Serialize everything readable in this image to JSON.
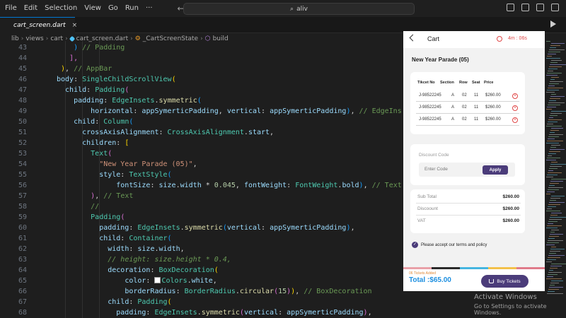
{
  "menu": [
    "File",
    "Edit",
    "Selection",
    "View",
    "Go",
    "Run",
    "···"
  ],
  "search": {
    "text": "aliv"
  },
  "tab": {
    "label": "cart_screen.dart",
    "close": "×"
  },
  "breadcrumb": [
    "lib",
    "views",
    "cart",
    "cart_screen.dart",
    "_CartScreenState",
    "build"
  ],
  "code_lines": [
    {
      "num": "43",
      "indent": 8,
      "tokens": [
        {
          "t": ") ",
          "c": "br3"
        },
        {
          "t": "// Padding",
          "c": "c"
        }
      ]
    },
    {
      "num": "44",
      "indent": 7,
      "tokens": [
        {
          "t": "],",
          "c": "br2"
        }
      ]
    },
    {
      "num": "45",
      "indent": 5,
      "tokens": [
        {
          "t": ")",
          "c": "br1"
        },
        {
          "t": ", ",
          "c": "txt"
        },
        {
          "t": "// AppBar",
          "c": "c"
        }
      ]
    },
    {
      "num": "46",
      "indent": 4,
      "tokens": [
        {
          "t": "body",
          "c": "p"
        },
        {
          "t": ": ",
          "c": "txt"
        },
        {
          "t": "SingleChildScrollView",
          "c": "k"
        },
        {
          "t": "(",
          "c": "br1"
        }
      ]
    },
    {
      "num": "47",
      "indent": 6,
      "tokens": [
        {
          "t": "child",
          "c": "p"
        },
        {
          "t": ": ",
          "c": "txt"
        },
        {
          "t": "Padding",
          "c": "k"
        },
        {
          "t": "(",
          "c": "br2"
        }
      ]
    },
    {
      "num": "48",
      "indent": 8,
      "tokens": [
        {
          "t": "padding",
          "c": "p"
        },
        {
          "t": ": ",
          "c": "txt"
        },
        {
          "t": "EdgeInsets",
          "c": "k"
        },
        {
          "t": ".",
          "c": "txt"
        },
        {
          "t": "symmetric",
          "c": "f"
        },
        {
          "t": "(",
          "c": "br3"
        }
      ]
    },
    {
      "num": "49",
      "indent": 12,
      "tokens": [
        {
          "t": "horizontal",
          "c": "p"
        },
        {
          "t": ": ",
          "c": "txt"
        },
        {
          "t": "appSymerticPadding",
          "c": "p"
        },
        {
          "t": ", ",
          "c": "txt"
        },
        {
          "t": "vertical",
          "c": "p"
        },
        {
          "t": ": ",
          "c": "txt"
        },
        {
          "t": "appSymerticPadding",
          "c": "p"
        },
        {
          "t": ")",
          "c": "br3"
        },
        {
          "t": ", ",
          "c": "txt"
        },
        {
          "t": "// EdgeIns",
          "c": "c"
        }
      ]
    },
    {
      "num": "50",
      "indent": 8,
      "tokens": [
        {
          "t": "child",
          "c": "p"
        },
        {
          "t": ": ",
          "c": "txt"
        },
        {
          "t": "Column",
          "c": "k"
        },
        {
          "t": "(",
          "c": "br3"
        }
      ]
    },
    {
      "num": "51",
      "indent": 10,
      "tokens": [
        {
          "t": "crossAxisAlignment",
          "c": "p"
        },
        {
          "t": ": ",
          "c": "txt"
        },
        {
          "t": "CrossAxisAlignment",
          "c": "k"
        },
        {
          "t": ".",
          "c": "txt"
        },
        {
          "t": "start",
          "c": "p"
        },
        {
          "t": ",",
          "c": "txt"
        }
      ]
    },
    {
      "num": "52",
      "indent": 10,
      "tokens": [
        {
          "t": "children",
          "c": "p"
        },
        {
          "t": ": ",
          "c": "txt"
        },
        {
          "t": "[",
          "c": "br1"
        }
      ]
    },
    {
      "num": "53",
      "indent": 12,
      "tokens": [
        {
          "t": "Text",
          "c": "k"
        },
        {
          "t": "(",
          "c": "br2"
        }
      ]
    },
    {
      "num": "54",
      "indent": 14,
      "tokens": [
        {
          "t": "\"New Year Parade (05)\"",
          "c": "s"
        },
        {
          "t": ",",
          "c": "txt"
        }
      ]
    },
    {
      "num": "55",
      "indent": 14,
      "tokens": [
        {
          "t": "style",
          "c": "p"
        },
        {
          "t": ": ",
          "c": "txt"
        },
        {
          "t": "TextStyle",
          "c": "k"
        },
        {
          "t": "(",
          "c": "br3"
        }
      ]
    },
    {
      "num": "56",
      "indent": 18,
      "tokens": [
        {
          "t": "fontSize",
          "c": "p"
        },
        {
          "t": ": ",
          "c": "txt"
        },
        {
          "t": "size",
          "c": "p"
        },
        {
          "t": ".",
          "c": "txt"
        },
        {
          "t": "width",
          "c": "p"
        },
        {
          "t": " * ",
          "c": "txt"
        },
        {
          "t": "0.045",
          "c": "n"
        },
        {
          "t": ", ",
          "c": "txt"
        },
        {
          "t": "fontWeight",
          "c": "p"
        },
        {
          "t": ": ",
          "c": "txt"
        },
        {
          "t": "FontWeight",
          "c": "k"
        },
        {
          "t": ".",
          "c": "txt"
        },
        {
          "t": "bold",
          "c": "p"
        },
        {
          "t": ")",
          "c": "br3"
        },
        {
          "t": ", ",
          "c": "txt"
        },
        {
          "t": "// Text",
          "c": "c"
        }
      ]
    },
    {
      "num": "57",
      "indent": 12,
      "tokens": [
        {
          "t": ")",
          "c": "br2"
        },
        {
          "t": ", ",
          "c": "txt"
        },
        {
          "t": "// Text",
          "c": "c"
        }
      ]
    },
    {
      "num": "58",
      "indent": 12,
      "tokens": [
        {
          "t": "//",
          "c": "c"
        }
      ]
    },
    {
      "num": "59",
      "indent": 12,
      "tokens": [
        {
          "t": "Padding",
          "c": "k"
        },
        {
          "t": "(",
          "c": "br2"
        }
      ]
    },
    {
      "num": "60",
      "indent": 14,
      "tokens": [
        {
          "t": "padding",
          "c": "p"
        },
        {
          "t": ": ",
          "c": "txt"
        },
        {
          "t": "EdgeInsets",
          "c": "k"
        },
        {
          "t": ".",
          "c": "txt"
        },
        {
          "t": "symmetric",
          "c": "f"
        },
        {
          "t": "(",
          "c": "br3"
        },
        {
          "t": "vertical",
          "c": "p"
        },
        {
          "t": ": ",
          "c": "txt"
        },
        {
          "t": "appSymerticPadding",
          "c": "p"
        },
        {
          "t": ")",
          "c": "br3"
        },
        {
          "t": ",",
          "c": "txt"
        }
      ]
    },
    {
      "num": "61",
      "indent": 14,
      "tokens": [
        {
          "t": "child",
          "c": "p"
        },
        {
          "t": ": ",
          "c": "txt"
        },
        {
          "t": "Container",
          "c": "k"
        },
        {
          "t": "(",
          "c": "br3"
        }
      ]
    },
    {
      "num": "62",
      "indent": 16,
      "tokens": [
        {
          "t": "width",
          "c": "p"
        },
        {
          "t": ": ",
          "c": "txt"
        },
        {
          "t": "size",
          "c": "p"
        },
        {
          "t": ".",
          "c": "txt"
        },
        {
          "t": "width",
          "c": "p"
        },
        {
          "t": ",",
          "c": "txt"
        }
      ]
    },
    {
      "num": "63",
      "indent": 16,
      "tokens": [
        {
          "t": "// height: size.height * 0.4,",
          "c": "ci"
        }
      ]
    },
    {
      "num": "64",
      "indent": 16,
      "tokens": [
        {
          "t": "decoration",
          "c": "p"
        },
        {
          "t": ": ",
          "c": "txt"
        },
        {
          "t": "BoxDecoration",
          "c": "k"
        },
        {
          "t": "(",
          "c": "br1"
        }
      ]
    },
    {
      "num": "65",
      "indent": 20,
      "swatch": true,
      "tokens": [
        {
          "t": "color",
          "c": "p"
        },
        {
          "t": ": ",
          "c": "txt"
        },
        {
          "t": "SWATCH",
          "c": "sw"
        },
        {
          "t": "Colors",
          "c": "k"
        },
        {
          "t": ".",
          "c": "txt"
        },
        {
          "t": "white",
          "c": "p"
        },
        {
          "t": ",",
          "c": "txt"
        }
      ]
    },
    {
      "num": "66",
      "indent": 20,
      "tokens": [
        {
          "t": "borderRadius",
          "c": "p"
        },
        {
          "t": ": ",
          "c": "txt"
        },
        {
          "t": "BorderRadius",
          "c": "k"
        },
        {
          "t": ".",
          "c": "txt"
        },
        {
          "t": "circular",
          "c": "f"
        },
        {
          "t": "(",
          "c": "br2"
        },
        {
          "t": "15",
          "c": "n"
        },
        {
          "t": ")",
          "c": "br2"
        },
        {
          "t": ")",
          "c": "br1"
        },
        {
          "t": ", ",
          "c": "txt"
        },
        {
          "t": "// BoxDecoration",
          "c": "c"
        }
      ]
    },
    {
      "num": "67",
      "indent": 16,
      "tokens": [
        {
          "t": "child",
          "c": "p"
        },
        {
          "t": ": ",
          "c": "txt"
        },
        {
          "t": "Padding",
          "c": "k"
        },
        {
          "t": "(",
          "c": "br1"
        }
      ]
    },
    {
      "num": "68",
      "indent": 18,
      "tokens": [
        {
          "t": "padding",
          "c": "p"
        },
        {
          "t": ": ",
          "c": "txt"
        },
        {
          "t": "EdgeInsets",
          "c": "k"
        },
        {
          "t": ".",
          "c": "txt"
        },
        {
          "t": "symmetric",
          "c": "f"
        },
        {
          "t": "(",
          "c": "br2"
        },
        {
          "t": "vertical",
          "c": "p"
        },
        {
          "t": ": ",
          "c": "txt"
        },
        {
          "t": "appSymerticPadding",
          "c": "p"
        },
        {
          "t": ")",
          "c": "br2"
        },
        {
          "t": ",",
          "c": "txt"
        }
      ]
    }
  ],
  "phone": {
    "appbar_title": "Cart",
    "timer": "4m : 06s",
    "event_title": "New Year Parade (05)",
    "ticket_headers": [
      "Tikcet No",
      "Section",
      "Row",
      "Seat",
      "Price"
    ],
    "tickets": [
      {
        "no": "J-98522245",
        "section": "A",
        "row": "02",
        "seat": "11",
        "price": "$260.00"
      },
      {
        "no": "J-98522245",
        "section": "A",
        "row": "02",
        "seat": "11",
        "price": "$260.00"
      },
      {
        "no": "J-98522245",
        "section": "A",
        "row": "02",
        "seat": "11",
        "price": "$260.00"
      }
    ],
    "discount_label": "Discount Code",
    "code_placeholder": "Enter Code",
    "apply_label": "Apply",
    "summary": [
      {
        "label": "Sub Total",
        "value": "$260.00"
      },
      {
        "label": "Discoount",
        "value": "$260.00"
      },
      {
        "label": "VAT",
        "value": "$260.00"
      }
    ],
    "terms": "Please accept our terms and policy",
    "tickets_added": "06 Tickets Added",
    "total": "Total :$65.00",
    "buy_label": "Buy Tickets",
    "stripe_colors": [
      "#e9a0a8",
      "#2a2a2a",
      "#45b5e0",
      "#f3c14b",
      "#e07b8a"
    ]
  },
  "watermark": {
    "title": "Activate Windows",
    "subtitle": "Go to Settings to activate Windows."
  },
  "colors": {
    "accent": "#0078d4",
    "phone_primary": "#4b3c7a",
    "timer_red": "#e04848",
    "total_blue": "#1d8fe0"
  }
}
